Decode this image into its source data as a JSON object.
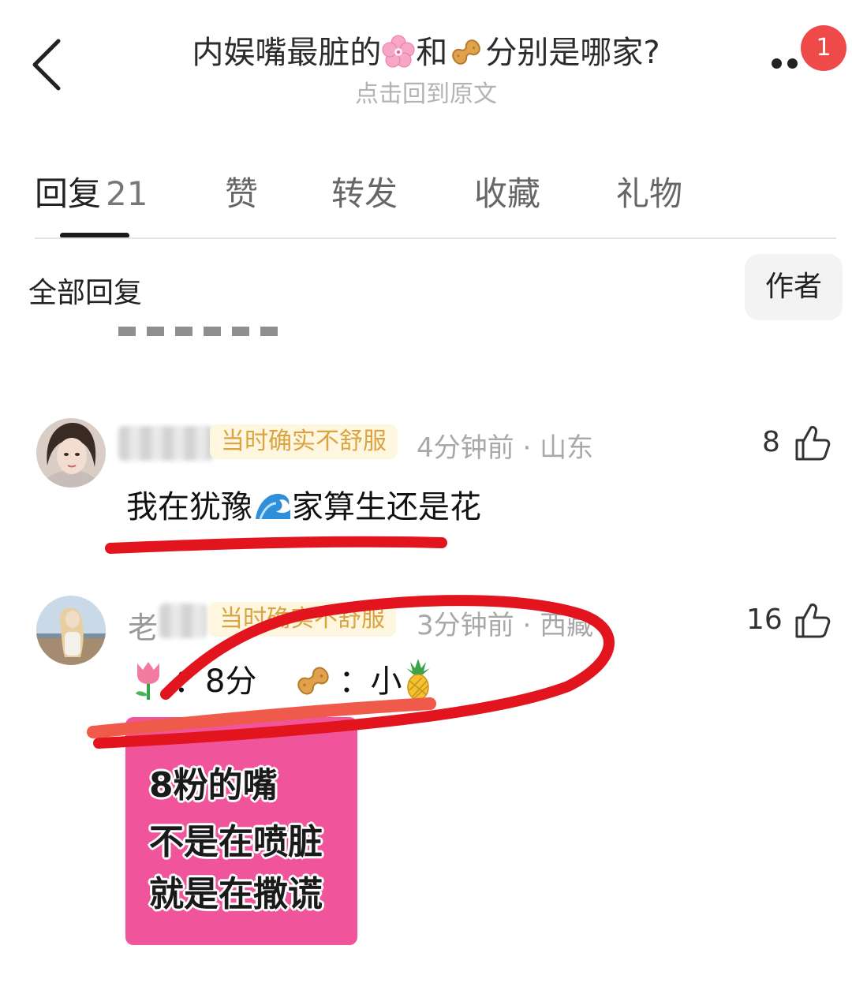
{
  "header": {
    "title_prefix": "内娱嘴最脏的",
    "title_middle": "和",
    "title_suffix": "分别是哪家?",
    "subtitle": "点击回到原文",
    "notification_count": "1"
  },
  "tabs": [
    {
      "label": "回复",
      "count": "21",
      "active": true
    },
    {
      "label": "赞"
    },
    {
      "label": "转发"
    },
    {
      "label": "收藏"
    },
    {
      "label": "礼物"
    }
  ],
  "section": {
    "title": "全部回复",
    "filter_label": "作者"
  },
  "comments": [
    {
      "flair": "当时确实不舒服",
      "time": "4分钟前",
      "location": "山东",
      "likes": "8",
      "text_part1": "我在犹豫",
      "text_part2": "家算生还是花"
    },
    {
      "name_visible": "老",
      "flair": "当时确实不舒服",
      "time": "3分钟前",
      "location": "西藏",
      "likes": "16",
      "text_a": "：8分",
      "text_b": "：小",
      "sticker_lines": [
        "8粉的嘴",
        "不是在喷脏",
        "就是在撒谎"
      ]
    }
  ],
  "colors": {
    "accent_red": "#ef4a4a",
    "annotation_red": "#e2141e",
    "flair_text": "#d9a441",
    "sticker_pink": "#f0559b"
  },
  "icons": [
    "back-chevron-icon",
    "more-icon",
    "thumb-up-icon",
    "cherry-blossom-icon",
    "peanut-icon",
    "wave-icon",
    "tulip-icon",
    "pineapple-icon"
  ]
}
